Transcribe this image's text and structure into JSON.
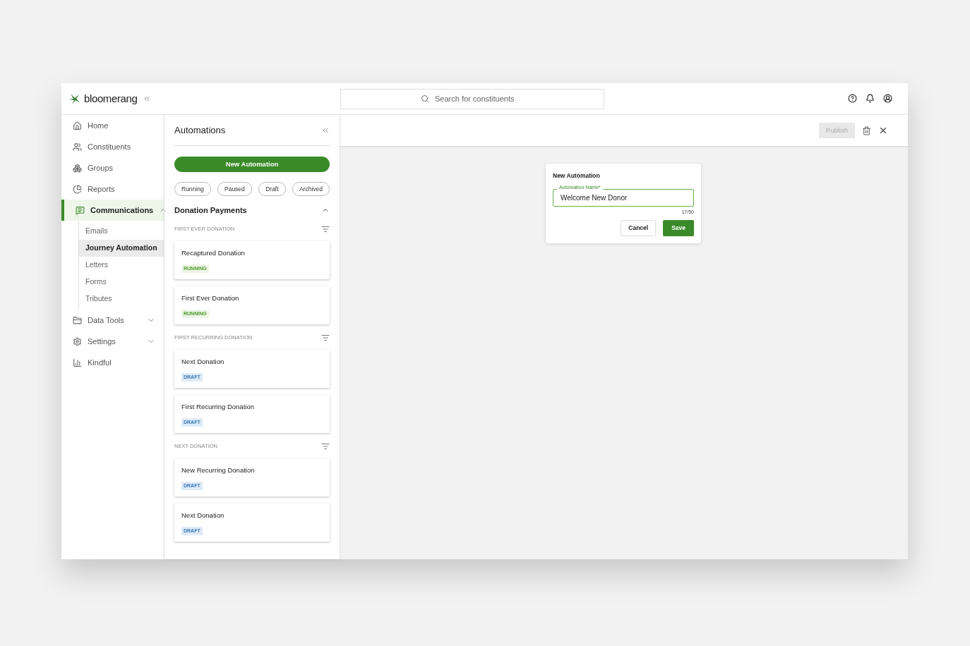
{
  "brand": {
    "name": "bloomerang"
  },
  "search": {
    "placeholder": "Search for constituents"
  },
  "sidebar": {
    "items": [
      {
        "label": "Home",
        "selected": false
      },
      {
        "label": "Constituents",
        "selected": false
      },
      {
        "label": "Groups",
        "selected": false
      },
      {
        "label": "Reports",
        "selected": false
      },
      {
        "label": "Communications",
        "selected": true,
        "expanded": true,
        "children": [
          {
            "label": "Emails",
            "selected": false
          },
          {
            "label": "Journey Automation",
            "selected": true
          },
          {
            "label": "Letters",
            "selected": false
          },
          {
            "label": "Forms",
            "selected": false
          },
          {
            "label": "Tributes",
            "selected": false
          }
        ]
      },
      {
        "label": "Data Tools",
        "selected": false,
        "expanded": false
      },
      {
        "label": "Settings",
        "selected": false,
        "expanded": false
      },
      {
        "label": "Kindful",
        "selected": false
      }
    ]
  },
  "panel": {
    "title": "Automations",
    "new_button": "New Automation",
    "filters": [
      {
        "label": "Running",
        "selected": false
      },
      {
        "label": "Paused",
        "selected": false
      },
      {
        "label": "Draft",
        "selected": false
      },
      {
        "label": "Archived",
        "selected": false
      }
    ],
    "group": {
      "title": "Donation Payments",
      "expanded": true,
      "sections": [
        {
          "label": "FIRST EVER DONATION",
          "cards": [
            {
              "title": "Recaptured Donation",
              "status": {
                "label": "RUNNING",
                "kind": "running"
              }
            },
            {
              "title": "First Ever Donation",
              "status": {
                "label": "RUNNING",
                "kind": "running"
              }
            }
          ]
        },
        {
          "label": "FIRST RECURRING DONATION",
          "cards": [
            {
              "title": "Next Donation",
              "status": {
                "label": "DRAFT",
                "kind": "draft"
              }
            },
            {
              "title": "First Recurring Donation",
              "status": {
                "label": "DRAFT",
                "kind": "draft"
              }
            }
          ]
        },
        {
          "label": "NEXT DONATION",
          "cards": [
            {
              "title": "New Recurring Donation",
              "status": {
                "label": "DRAFT",
                "kind": "draft"
              }
            },
            {
              "title": "Next Donation",
              "status": {
                "label": "DRAFT",
                "kind": "draft"
              }
            }
          ]
        }
      ]
    }
  },
  "toolbar": {
    "publish": {
      "label": "Publish",
      "disabled": true
    }
  },
  "dialog": {
    "title": "New Automation",
    "field": {
      "label": "Automation Name*",
      "value": "Welcome New Donor",
      "counter": "17/50"
    },
    "cancel": "Cancel",
    "save": "Save"
  }
}
